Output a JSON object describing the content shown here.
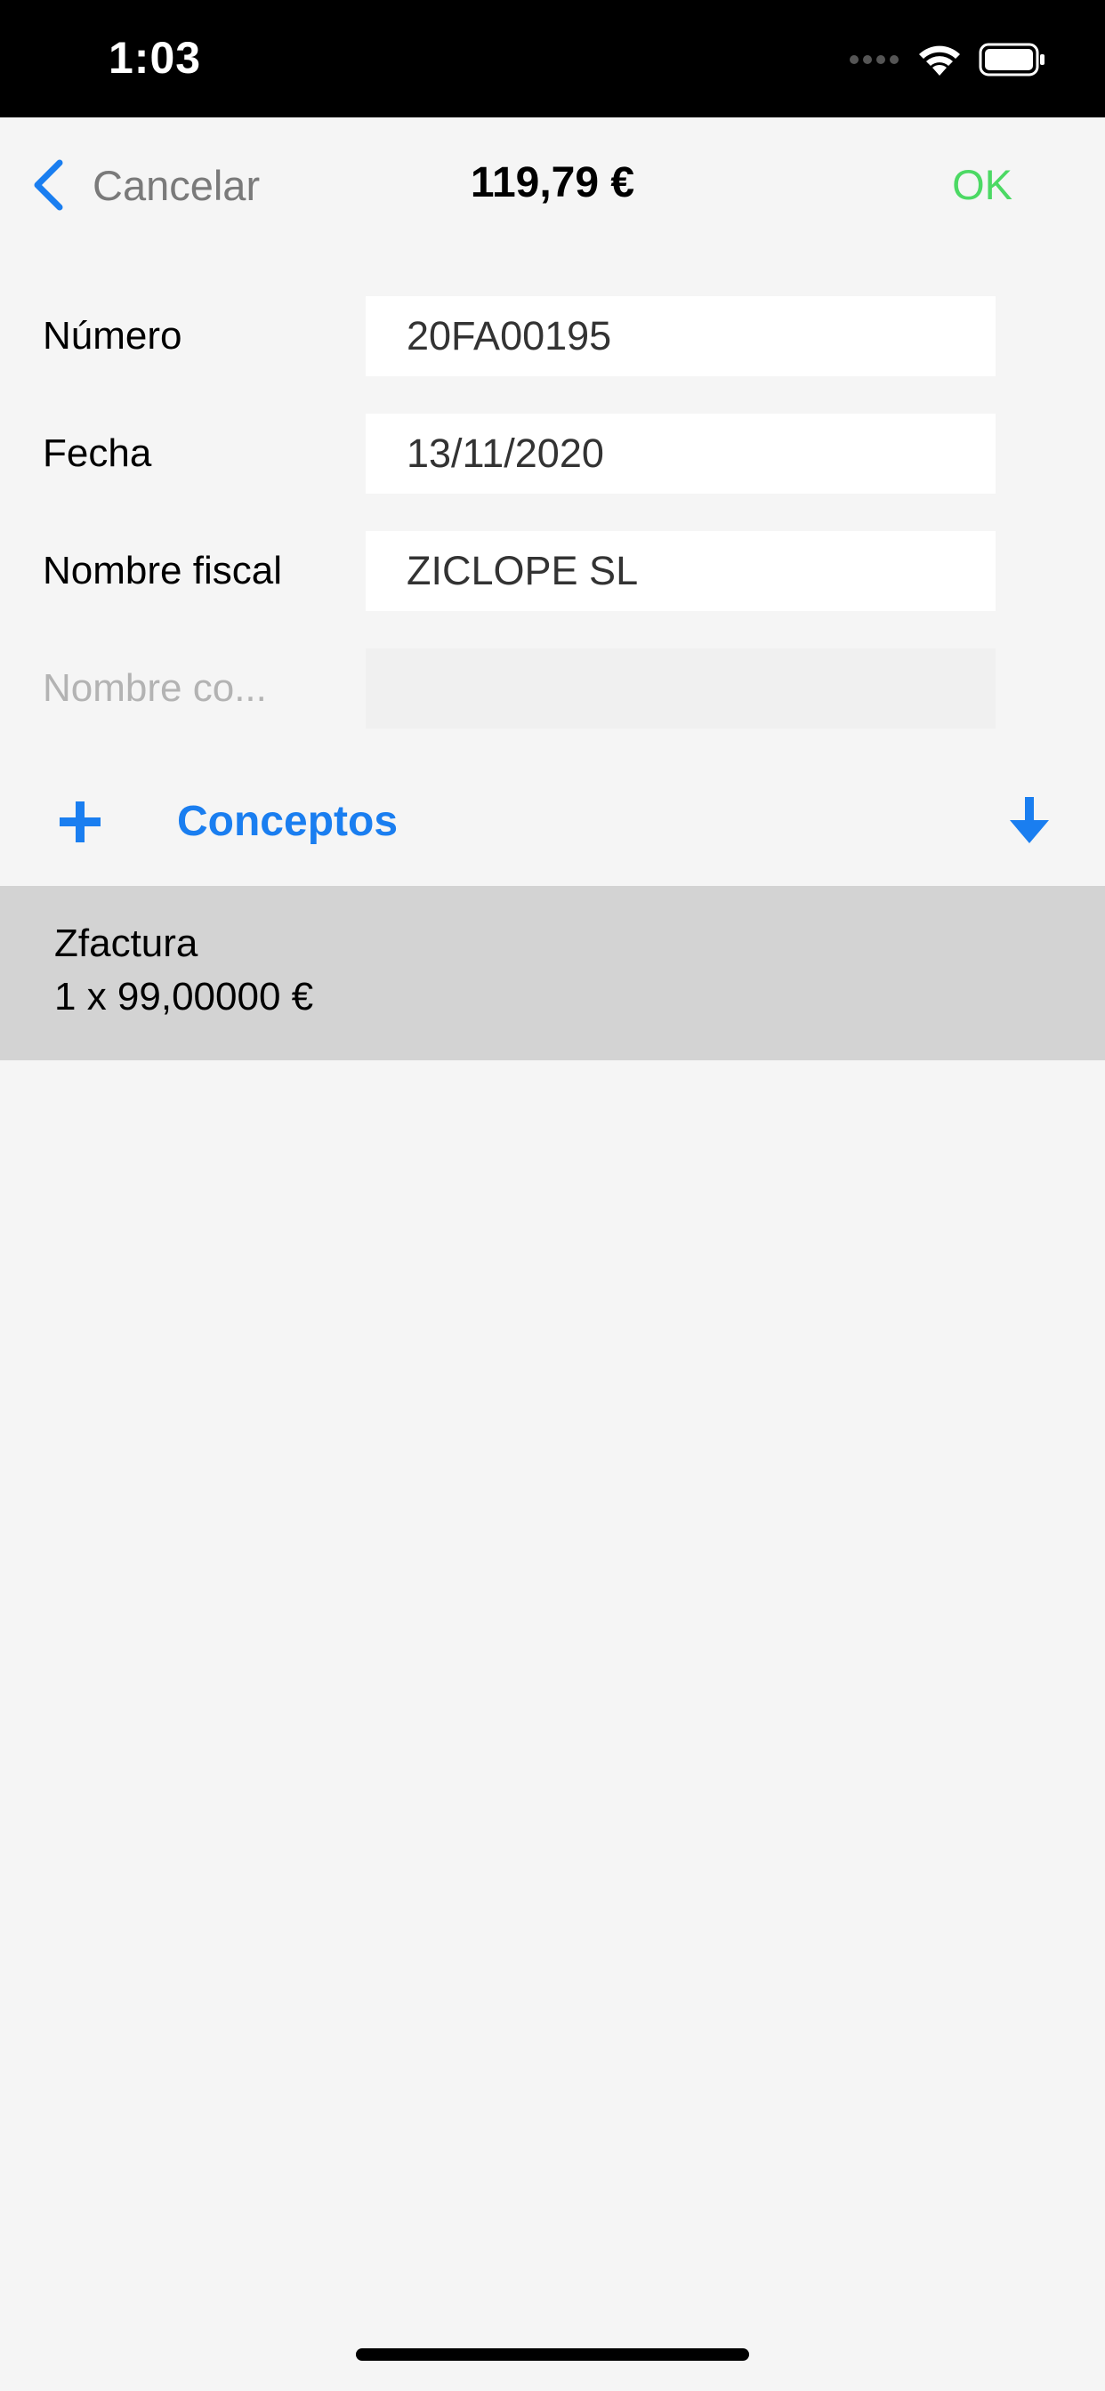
{
  "status_bar": {
    "time": "1:03",
    "icons": [
      "signal-dots-icon",
      "wifi-icon",
      "battery-icon"
    ]
  },
  "nav": {
    "back_label": "Cancelar",
    "title": "119,79 €",
    "ok_label": "OK",
    "accent_color": "#4cd964",
    "back_icon": "chevron-left-icon"
  },
  "form": {
    "numero": {
      "label": "Número",
      "value": "20FA00195"
    },
    "fecha": {
      "label": "Fecha",
      "value": "13/11/2020"
    },
    "nombre_fiscal": {
      "label": "Nombre fiscal",
      "value": "ZICLOPE SL"
    },
    "nombre_comercial": {
      "placeholder_label": "Nombre co...",
      "value": ""
    }
  },
  "concepts": {
    "label": "Conceptos",
    "color": "#1a7ef0",
    "add_icon": "plus-icon",
    "download_icon": "arrow-down-icon",
    "items": [
      {
        "name": "Zfactura",
        "detail": "1 x 99,00000 €"
      }
    ]
  }
}
